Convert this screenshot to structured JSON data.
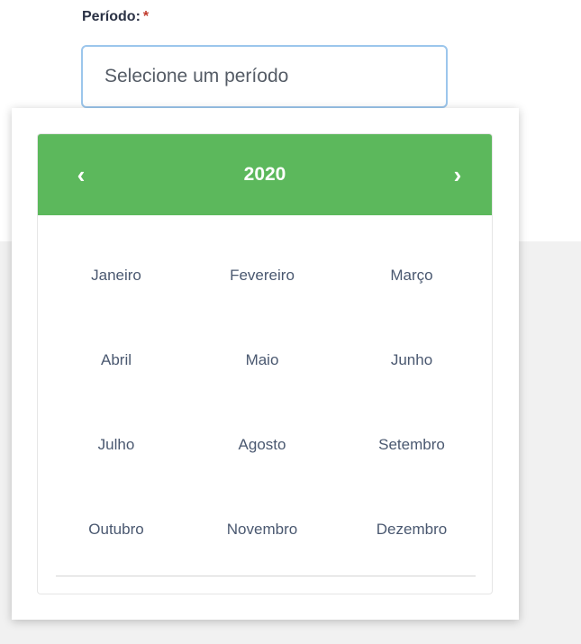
{
  "form": {
    "label": "Período:",
    "required_mark": "*",
    "input_placeholder": "Selecione um período",
    "input_value": ""
  },
  "picker": {
    "prev_icon": "‹",
    "next_icon": "›",
    "year": "2020",
    "header_color": "#5cb85c",
    "months": [
      "Janeiro",
      "Fevereiro",
      "Março",
      "Abril",
      "Maio",
      "Junho",
      "Julho",
      "Agosto",
      "Setembro",
      "Outubro",
      "Novembro",
      "Dezembro"
    ]
  }
}
